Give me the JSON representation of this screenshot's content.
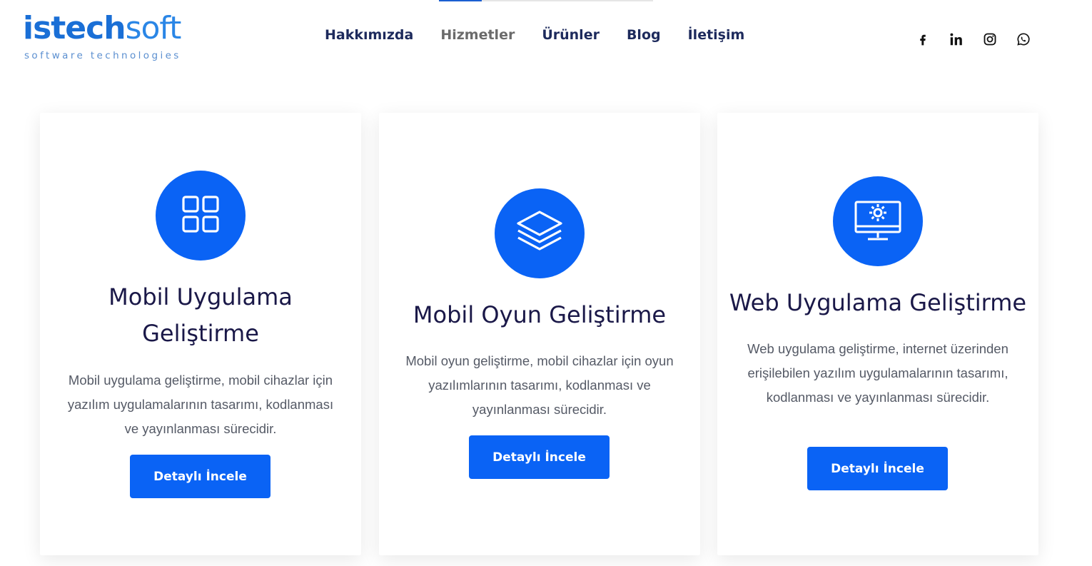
{
  "brand": {
    "name_bold": "istech",
    "name_light": "soft",
    "tagline": "software technologies",
    "color_primary": "#1a6fd6"
  },
  "nav": {
    "items": [
      {
        "label": "Hakkımızda",
        "active": false
      },
      {
        "label": "Hizmetler",
        "active": true
      },
      {
        "label": "Ürünler",
        "active": false
      },
      {
        "label": "Blog",
        "active": false
      },
      {
        "label": "İletişim",
        "active": false
      }
    ]
  },
  "social": {
    "icons": [
      "facebook-icon",
      "linkedin-icon",
      "instagram-icon",
      "whatsapp-icon"
    ]
  },
  "colors": {
    "accent": "#0a63f5",
    "title": "#1a1848",
    "text": "#555a66",
    "nav": "#1d2a5c"
  },
  "cards": [
    {
      "icon": "grid-icon",
      "title": "Mobil Uygulama Geliştirme",
      "description": "Mobil uygulama geliştirme, mobil cihazlar için yazılım uygulamalarının tasarımı, kodlanması ve yayınlanması sürecidir.",
      "button_label": "Detaylı İncele"
    },
    {
      "icon": "layers-icon",
      "title": "Mobil Oyun Geliştirme",
      "description": "Mobil oyun geliştirme, mobil cihazlar için oyun yazılımlarının tasarımı, kodlanması ve yayınlanması sürecidir.",
      "button_label": "Detaylı İncele"
    },
    {
      "icon": "monitor-gear-icon",
      "title": "Web Uygulama Geliştirme",
      "description": "Web uygulama geliştirme, internet üzerinden erişilebilen yazılım uygulamalarının tasarımı, kodlanması ve yayınlanması sürecidir.",
      "button_label": "Detaylı İncele"
    }
  ]
}
